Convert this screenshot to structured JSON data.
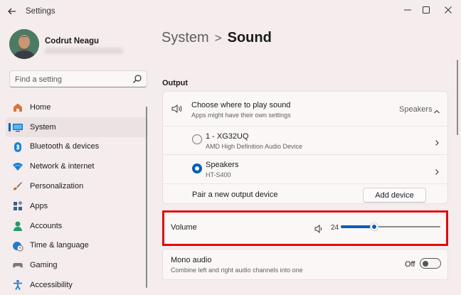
{
  "window": {
    "app_title": "Settings"
  },
  "profile": {
    "name": "Codrut Neagu"
  },
  "search": {
    "placeholder": "Find a setting"
  },
  "nav": {
    "items": [
      {
        "label": "Home",
        "icon": "home-icon",
        "color": "#d8743a"
      },
      {
        "label": "System",
        "icon": "system-icon",
        "color": "#0a6cc9",
        "active": true
      },
      {
        "label": "Bluetooth & devices",
        "icon": "bluetooth-icon",
        "color": "#1a7fd4"
      },
      {
        "label": "Network & internet",
        "icon": "wifi-icon",
        "color": "#1a7fd4"
      },
      {
        "label": "Personalization",
        "icon": "brush-icon",
        "color": "#c9642a"
      },
      {
        "label": "Apps",
        "icon": "apps-icon",
        "color": "#3b5f86"
      },
      {
        "label": "Accounts",
        "icon": "accounts-icon",
        "color": "#1f9d6a"
      },
      {
        "label": "Time & language",
        "icon": "globe-clock-icon",
        "color": "#1a7fd4"
      },
      {
        "label": "Gaming",
        "icon": "gamepad-icon",
        "color": "#7a7a7a"
      },
      {
        "label": "Accessibility",
        "icon": "accessibility-icon",
        "color": "#1a7fd4"
      }
    ]
  },
  "breadcrumb": {
    "parent": "System",
    "separator": ">",
    "current": "Sound"
  },
  "output": {
    "section_title": "Output",
    "choose": {
      "title": "Choose where to play sound",
      "subtitle": "Apps might have their own settings",
      "value": "Speakers"
    },
    "devices": [
      {
        "name": "1 - XG32UQ",
        "detail": "AMD High Definition Audio Device",
        "selected": false
      },
      {
        "name": "Speakers",
        "detail": "HT-S400",
        "selected": true
      }
    ],
    "pair": {
      "label": "Pair a new output device",
      "button": "Add device"
    },
    "volume": {
      "label": "Volume",
      "value_text": "24",
      "level": 24
    },
    "mono": {
      "title": "Mono audio",
      "subtitle": "Combine left and right audio channels into one",
      "state": "Off"
    }
  },
  "colors": {
    "accent": "#005fb8",
    "highlight": "#e10a0a"
  }
}
